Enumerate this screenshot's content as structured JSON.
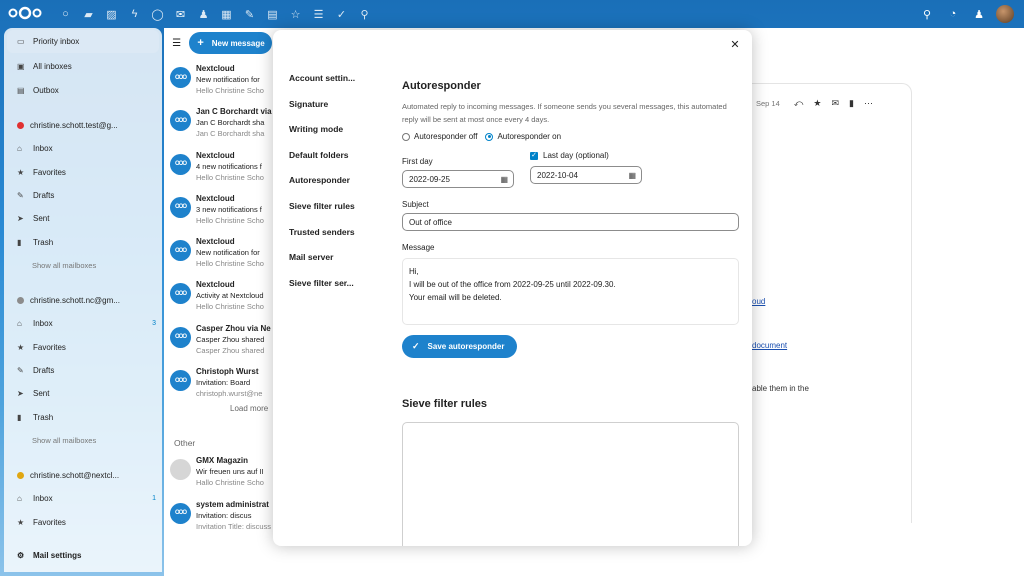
{
  "header": {
    "app_icons": [
      "dashboard-icon",
      "files-icon",
      "photos-icon",
      "activity-icon",
      "talk-icon",
      "mail-icon",
      "contacts-icon",
      "calendar-icon",
      "notes-icon",
      "deck-icon",
      "forms-icon",
      "tasks-icon",
      "checkmarks-icon",
      "maps-icon"
    ],
    "right_icons": [
      "search-icon",
      "notifications-icon",
      "contacts-menu-icon"
    ]
  },
  "nav": {
    "priority_inbox": "Priority inbox",
    "all_inboxes": "All inboxes",
    "outbox": "Outbox",
    "accounts": [
      {
        "email": "christine.schott.test@g...",
        "color": "#e03131",
        "inbox": "Inbox",
        "inbox_count": "",
        "favorites": "Favorites",
        "drafts": "Drafts",
        "sent": "Sent",
        "trash": "Trash",
        "show_all": "Show all mailboxes"
      },
      {
        "email": "christine.schott.nc@gm...",
        "color": "#8c8c8c",
        "inbox": "Inbox",
        "inbox_count": "3",
        "favorites": "Favorites",
        "drafts": "Drafts",
        "sent": "Sent",
        "trash": "Trash",
        "show_all": "Show all mailboxes"
      },
      {
        "email": "christine.schott@nextcl...",
        "color": "#e0a712",
        "inbox": "Inbox",
        "inbox_count": "1",
        "favorites": "Favorites"
      }
    ],
    "mail_settings": "Mail settings"
  },
  "list": {
    "new_message": "New message",
    "messages": [
      {
        "from": "Nextcloud",
        "subject": "New notification for",
        "preview": "Hello Christine Scho"
      },
      {
        "from": "Jan C Borchardt via",
        "subject": "Jan C Borchardt sha",
        "preview": "Jan C Borchardt sha"
      },
      {
        "from": "Nextcloud",
        "subject": "4 new notifications f",
        "preview": "Hello Christine Scho"
      },
      {
        "from": "Nextcloud",
        "subject": "3 new notifications f",
        "preview": "Hello Christine Scho"
      },
      {
        "from": "Nextcloud",
        "subject": "New notification for",
        "preview": "Hello Christine Scho"
      },
      {
        "from": "Nextcloud",
        "subject": "Activity at Nextcloud",
        "preview": "Hello Christine Scho"
      },
      {
        "from": "Casper Zhou via Ne",
        "subject": "Casper Zhou shared",
        "preview": "Casper Zhou shared"
      },
      {
        "from": "Christoph Wurst",
        "subject": "Invitation: Board",
        "preview": "christoph.wurst@ne"
      }
    ],
    "load_more": "Load more",
    "other_heading": "Other",
    "other_messages": [
      {
        "from": "GMX Magazin",
        "subject": "Wir freuen uns auf II",
        "preview": "Hallo Christine Scho"
      },
      {
        "from": "system administrat",
        "subject": "Invitation: discus",
        "preview": "Invitation  Title: discuss the proj..."
      }
    ]
  },
  "pane": {
    "date": "Sep 14",
    "link1": "oud",
    "link2": "document",
    "text1": "able them in the"
  },
  "modal": {
    "settings_nav": [
      "Account settin...",
      "Signature",
      "Writing mode",
      "Default folders",
      "Autoresponder",
      "Sieve filter rules",
      "Trusted senders",
      "Mail server",
      "Sieve filter ser..."
    ],
    "autoresponder": {
      "title": "Autoresponder",
      "description": "Automated reply to incoming messages. If someone sends you several messages, this automated reply will be sent at most once every 4 days.",
      "off_label": "Autoresponder off",
      "on_label": "Autoresponder on",
      "selected": "on",
      "first_day_label": "First day",
      "first_day_value": "2022-09-25",
      "last_day_label": "Last day (optional)",
      "last_day_value": "2022-10-04",
      "last_day_checked": true,
      "subject_label": "Subject",
      "subject_value": "Out of office",
      "message_label": "Message",
      "message_lines": [
        "Hi,",
        "I will be out of the office from 2022-09-25 until 2022-09.30.",
        "Your email will be deleted."
      ],
      "save_label": "Save autoresponder"
    },
    "sieve": {
      "title": "Sieve filter rules"
    }
  }
}
